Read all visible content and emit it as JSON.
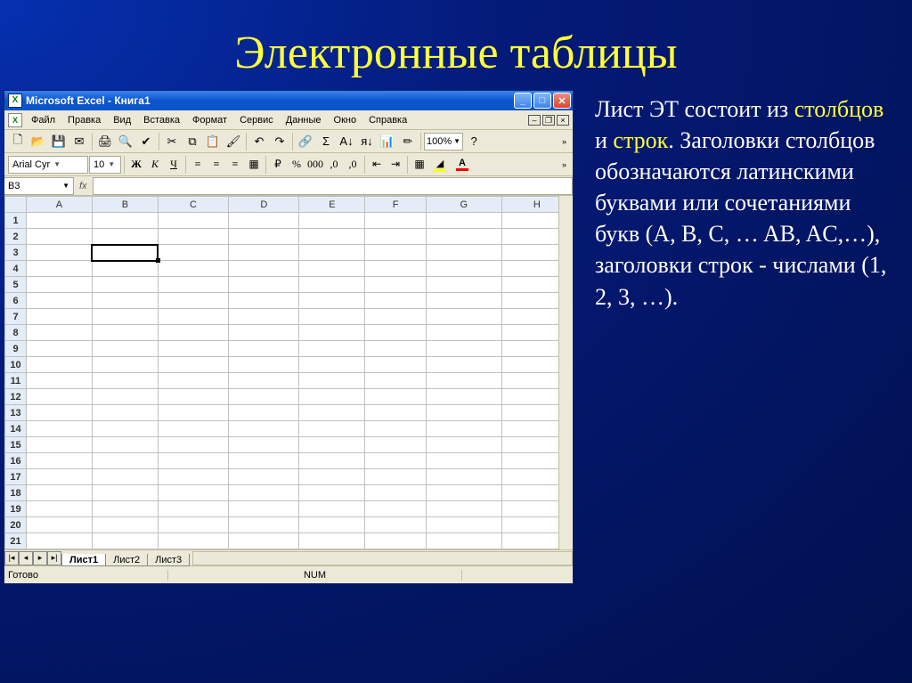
{
  "slide_title": "Электронные таблицы",
  "side_text": {
    "t1": "Лист ЭТ состоит из ",
    "h1": "столбцов",
    "t2": " и ",
    "h2": "строк",
    "t3": ". Заголовки столбцов обозначаются латинскими буквами или сочетаниями букв (A, B, C, … AB, AC,…), заголовки строк  - числами (1, 2, 3, …)."
  },
  "window": {
    "title": "Microsoft Excel - Книга1",
    "menu": [
      "Файл",
      "Правка",
      "Вид",
      "Вставка",
      "Формат",
      "Сервис",
      "Данные",
      "Окно",
      "Справка"
    ],
    "zoom": "100%",
    "font_name": "Arial Cyr",
    "font_size": "10",
    "name_box": "B3",
    "columns": [
      "A",
      "B",
      "C",
      "D",
      "E",
      "F",
      "G",
      "H"
    ],
    "rows": [
      "1",
      "2",
      "3",
      "4",
      "5",
      "6",
      "7",
      "8",
      "9",
      "10",
      "11",
      "12",
      "13",
      "14",
      "15",
      "16",
      "17",
      "18",
      "19",
      "20",
      "21"
    ],
    "active_cell": [
      2,
      1
    ],
    "sheets": [
      "Лист1",
      "Лист2",
      "Лист3"
    ],
    "active_sheet": 0,
    "status_ready": "Готово",
    "status_mode": "NUM"
  },
  "icons": {
    "new": "🗋",
    "open": "📂",
    "save": "💾",
    "mail": "✉",
    "print": "🖨",
    "preview": "🔍",
    "spell": "✔",
    "cut": "✂",
    "copy": "⧉",
    "paste": "📋",
    "brush": "🖌",
    "undo": "↶",
    "redo": "↷",
    "link": "🔗",
    "sum": "Σ",
    "sortaz": "A↓",
    "sortza": "я↓",
    "chart": "📊",
    "draw": "✏",
    "help": "?",
    "left": "≡",
    "center": "≡",
    "right": "≡",
    "merge": "▦",
    "currency": "₽",
    "percent": "%",
    "comma": ",0",
    "decinc": "←0",
    "decdec": "0→",
    "indent": "⇤",
    "outdent": "⇥",
    "borders": "▦",
    "fill": "▰",
    "font": "A"
  }
}
